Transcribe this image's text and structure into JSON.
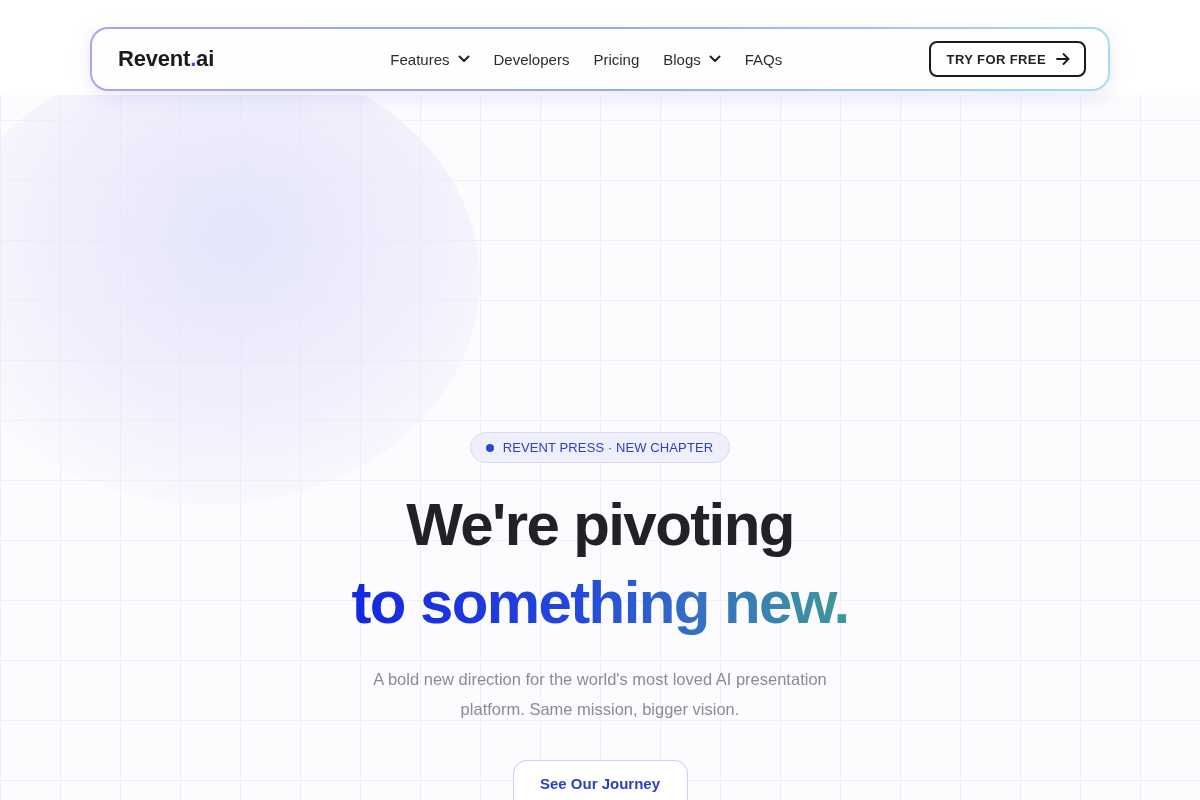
{
  "nav": {
    "logo": [
      {
        "text": "Revent",
        "accent": false
      },
      {
        "text": ".",
        "accent": true
      },
      {
        "text": "ai",
        "accent": false
      }
    ],
    "links": [
      {
        "label": "Features",
        "has_menu": true
      },
      {
        "label": "Developers",
        "has_menu": false
      },
      {
        "label": "Pricing",
        "has_menu": false
      },
      {
        "label": "Blogs",
        "has_menu": true
      },
      {
        "label": "FAQs",
        "has_menu": false
      }
    ],
    "cta": {
      "label": "TRY FOR FREE"
    }
  },
  "hero": {
    "badge": "REVENT PRESS · NEW CHAPTER",
    "headline": {
      "line_1": "We're pivoting",
      "line_2": "to something new."
    },
    "subtitle": "A bold new direction for the world's most loved AI presentation platform. Same mission, bigger vision.",
    "button": "See Our Journey"
  }
}
